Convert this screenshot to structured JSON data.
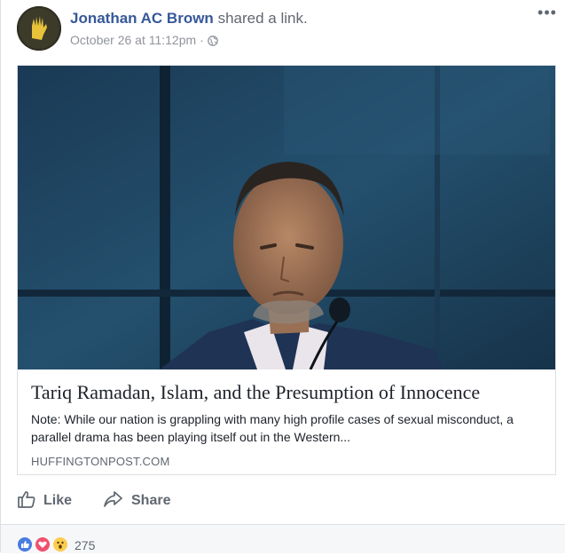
{
  "post": {
    "author": "Jonathan AC Brown",
    "action": "shared a link.",
    "timestamp": "October 26 at 11:12pm",
    "separator": "·",
    "privacy_icon": "globe-icon",
    "more_label": "•••"
  },
  "link": {
    "title": "Tariq Ramadan, Islam, and the Presumption of Innocence",
    "description": "Note: While our nation is grappling with many high profile cases of sexual misconduct, a parallel drama has been playing itself out in the Western...",
    "domain": "HUFFINGTONPOST.COM"
  },
  "actions": {
    "like_label": "Like",
    "share_label": "Share"
  },
  "reactions": {
    "types": [
      "like",
      "love",
      "wow"
    ],
    "count": "275"
  },
  "colors": {
    "author_link": "#365899",
    "meta": "#90949c",
    "action_text": "#606770",
    "like_reaction": "#4a7ce0",
    "love_reaction": "#f0506e",
    "wow_reaction": "#fccc4c"
  }
}
